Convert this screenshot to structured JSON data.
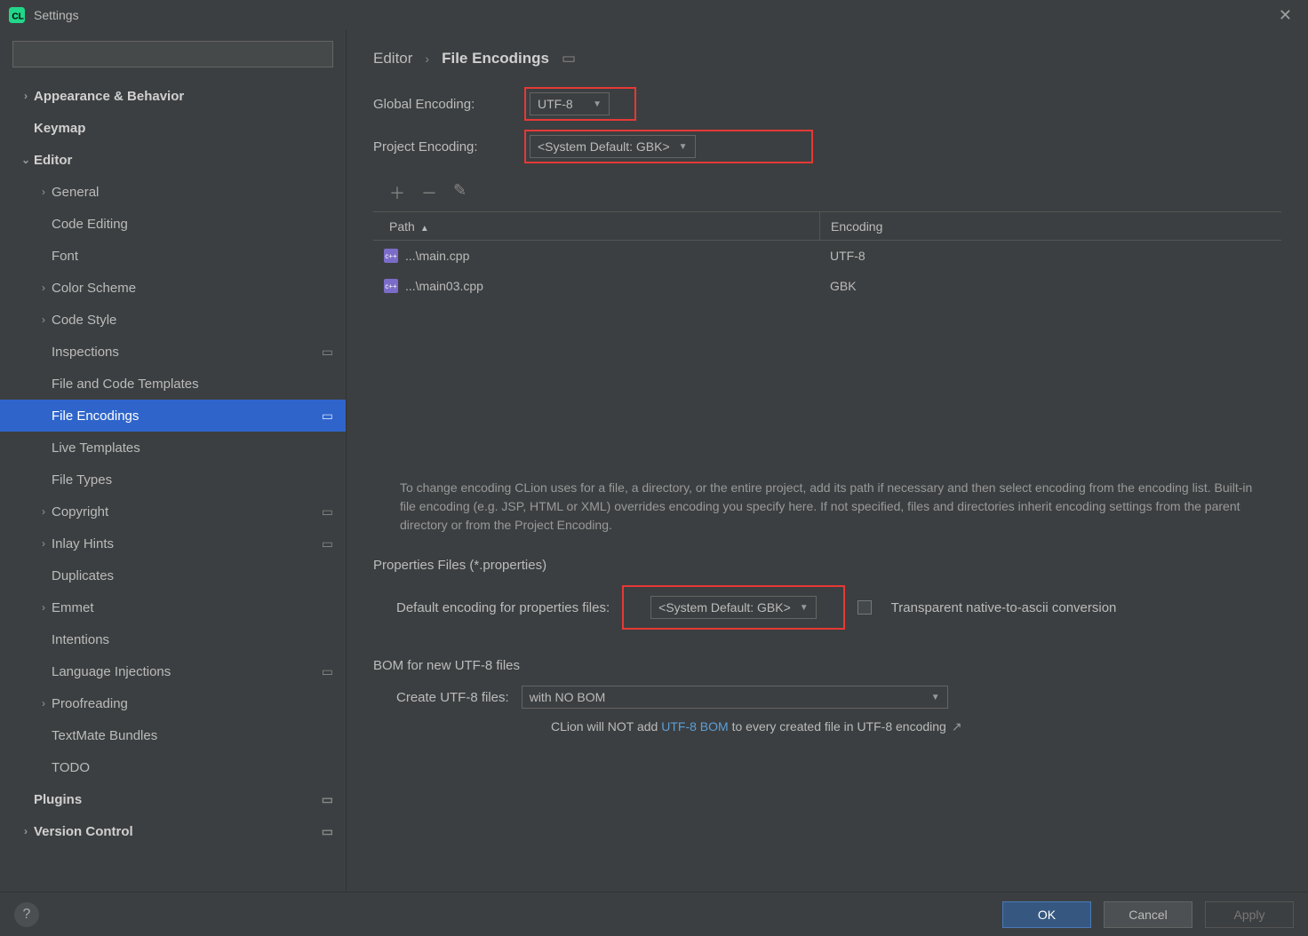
{
  "window": {
    "title": "Settings"
  },
  "search": {
    "placeholder": ""
  },
  "sidebar": {
    "items": [
      {
        "label": "Appearance & Behavior",
        "expandable": true,
        "bold": true,
        "level": 0
      },
      {
        "label": "Keymap",
        "expandable": false,
        "bold": true,
        "level": 0
      },
      {
        "label": "Editor",
        "expandable": true,
        "expanded": true,
        "bold": true,
        "level": 0
      },
      {
        "label": "General",
        "expandable": true,
        "level": 1
      },
      {
        "label": "Code Editing",
        "level": 1
      },
      {
        "label": "Font",
        "level": 1
      },
      {
        "label": "Color Scheme",
        "expandable": true,
        "level": 1
      },
      {
        "label": "Code Style",
        "expandable": true,
        "level": 1
      },
      {
        "label": "Inspections",
        "level": 1,
        "badge": "▭"
      },
      {
        "label": "File and Code Templates",
        "level": 1
      },
      {
        "label": "File Encodings",
        "level": 1,
        "selected": true,
        "badge": "▭"
      },
      {
        "label": "Live Templates",
        "level": 1
      },
      {
        "label": "File Types",
        "level": 1
      },
      {
        "label": "Copyright",
        "expandable": true,
        "level": 1,
        "badge": "▭"
      },
      {
        "label": "Inlay Hints",
        "expandable": true,
        "level": 1,
        "badge": "▭"
      },
      {
        "label": "Duplicates",
        "level": 1
      },
      {
        "label": "Emmet",
        "expandable": true,
        "level": 1
      },
      {
        "label": "Intentions",
        "level": 1
      },
      {
        "label": "Language Injections",
        "level": 1,
        "badge": "▭"
      },
      {
        "label": "Proofreading",
        "expandable": true,
        "level": 1
      },
      {
        "label": "TextMate Bundles",
        "level": 1
      },
      {
        "label": "TODO",
        "level": 1
      },
      {
        "label": "Plugins",
        "bold": true,
        "level": 0,
        "badge": "▭"
      },
      {
        "label": "Version Control",
        "expandable": true,
        "bold": true,
        "level": 0,
        "badge": "▭"
      }
    ]
  },
  "breadcrumb": {
    "root": "Editor",
    "current": "File Encodings"
  },
  "form": {
    "global_label": "Global Encoding:",
    "global_value": "UTF-8",
    "project_label": "Project Encoding:",
    "project_value": "<System Default: GBK>"
  },
  "table": {
    "path_header": "Path",
    "enc_header": "Encoding",
    "rows": [
      {
        "path": "...\\main.cpp",
        "enc": "UTF-8"
      },
      {
        "path": "...\\main03.cpp",
        "enc": "GBK"
      }
    ]
  },
  "help_text": "To change encoding CLion uses for a file, a directory, or the entire project, add its path if necessary and then select encoding from the encoding list. Built-in file encoding (e.g. JSP, HTML or XML) overrides encoding you specify here. If not specified, files and directories inherit encoding settings from the parent directory or from the Project Encoding.",
  "properties": {
    "section": "Properties Files (*.properties)",
    "label": "Default encoding for properties files:",
    "value": "<System Default: GBK>",
    "checkbox_label": "Transparent native-to-ascii conversion"
  },
  "bom": {
    "section": "BOM for new UTF-8 files",
    "label": "Create UTF-8 files:",
    "value": "with NO BOM",
    "hint_pre": "CLion will NOT add ",
    "hint_link": "UTF-8 BOM",
    "hint_post": " to every created file in UTF-8 encoding"
  },
  "footer": {
    "ok": "OK",
    "cancel": "Cancel",
    "apply": "Apply"
  }
}
